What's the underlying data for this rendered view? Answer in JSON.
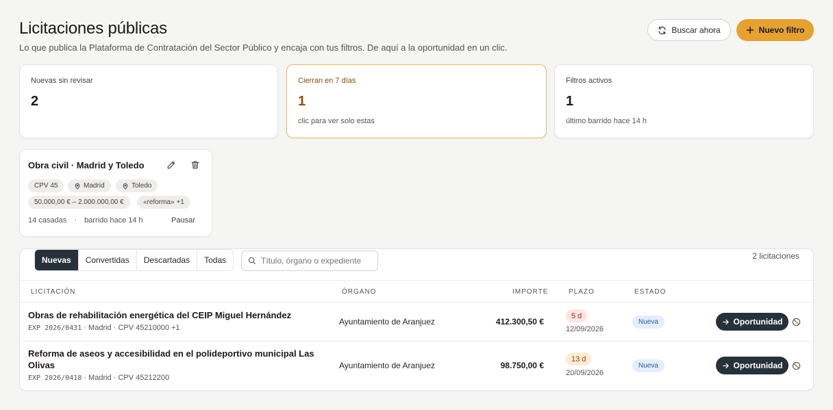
{
  "header": {
    "title": "Licitaciones públicas",
    "subtitle": "Lo que publica la Plataforma de Contratación del Sector Público y encaja con tus filtros. De aquí a la oportunidad en un clic.",
    "search_now_label": "Buscar ahora",
    "new_filter_label": "Nuevo filtro"
  },
  "stats": [
    {
      "label": "Nuevas sin revisar",
      "value": "2",
      "note": ""
    },
    {
      "label": "Cierran en 7 días",
      "value": "1",
      "note": "clic para ver solo estas"
    },
    {
      "label": "Filtros activos",
      "value": "1",
      "note": "último barrido hace 14 h"
    }
  ],
  "filter_card": {
    "title": "Obra civil · Madrid y Toledo",
    "chips": [
      "CPV 45",
      "Madrid",
      "Toledo",
      "50.000,00 € – 2.000.000,00 €",
      "«reforma» +1"
    ],
    "matches": "14 casadas",
    "sweep": "barrido hace 14 h",
    "pause_label": "Pausar"
  },
  "tabs": [
    "Nuevas",
    "Convertidas",
    "Descartadas",
    "Todas"
  ],
  "active_tab": "Nuevas",
  "search": {
    "placeholder": "Título, órgano o expediente"
  },
  "count_label": "2 licitaciones",
  "table": {
    "columns": [
      "LICITACIÓN",
      "ÓRGANO",
      "IMPORTE",
      "PLAZO",
      "ESTADO"
    ],
    "rows": [
      {
        "title": "Obras de rehabilitación energética del CEIP Miguel Hernández",
        "exp": "EXP 2026/0431",
        "meta": " · Madrid · CPV 45210000 +1",
        "organ": "Ayuntamiento de Aranjuez",
        "amount": "412.300,50 €",
        "days": "5 d",
        "date": "12/09/2026",
        "status": "Nueva",
        "action": "Oportunidad"
      },
      {
        "title": "Reforma de aseos y accesibilidad en el polideportivo municipal Las Olivas",
        "exp": "EXP 2026/0418",
        "meta": " · Madrid · CPV 45212200",
        "organ": "Ayuntamiento de Aranjuez",
        "amount": "98.750,00 €",
        "days": "13 d",
        "date": "20/09/2026",
        "status": "Nueva",
        "action": "Oportunidad"
      }
    ]
  },
  "colors": {
    "accent": "#e5a131",
    "dark": "#27313a",
    "urgent_bg": "#fde5e2",
    "urgent_fg": "#b3261e",
    "warn_bg": "#fdecd2",
    "warn_fg": "#8a4b0b",
    "status_bg": "#e4eefb",
    "status_fg": "#2a5a9b"
  },
  "icons": {
    "search_now": "refresh-icon",
    "new_filter": "plus-icon",
    "edit": "pencil-icon",
    "delete": "trash-icon",
    "location": "map-pin-icon",
    "search": "search-icon",
    "action": "arrow-right-icon",
    "discard": "ban-icon"
  }
}
